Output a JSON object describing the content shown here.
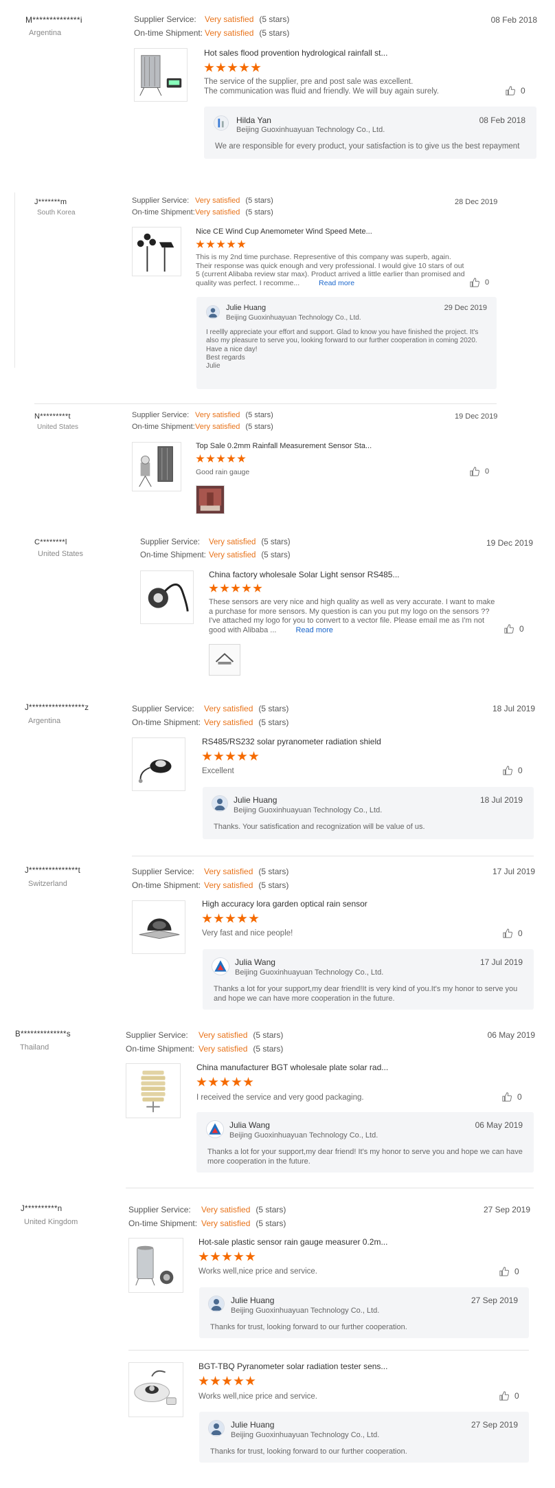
{
  "reviews": [
    {
      "buyer": "M**************i",
      "country": "Argentina",
      "supplier_label": "Supplier Service:",
      "supplier_value": "Very satisfied",
      "supplier_stars": "(5 stars)",
      "shipment_label": "On-time Shipment:",
      "shipment_value": "Very satisfied",
      "shipment_stars": "(5 stars)",
      "date": "08 Feb 2018",
      "products": [
        {
          "title": "Hot sales flood provention hydrological rainfall st...",
          "rating": 5,
          "text": "The service of the supplier, pre and post sale was excellent.\nThe communication was fluid and friendly. We will buy again surely.",
          "likes": "0",
          "thumb_icon": "rain-gauge-station-icon",
          "reply": {
            "name": "Hilda Yan",
            "company": "Beijing Guoxinhuayuan Technology Co., Ltd.",
            "date": "08 Feb 2018",
            "message": "We are responsible for every product, your satisfaction is to give us the best repayment"
          }
        }
      ]
    },
    {
      "buyer": "J*******m",
      "country": "South Korea",
      "supplier_label": "Supplier Service:",
      "supplier_value": "Very satisfied",
      "supplier_stars": "(5 stars)",
      "shipment_label": "On-time Shipment:",
      "shipment_value": "Very satisfied",
      "shipment_stars": "(5 stars)",
      "date": "28 Dec 2019",
      "products": [
        {
          "title": "Nice CE Wind Cup Anemometer Wind Speed Mete...",
          "rating": 5,
          "text": "This is my 2nd time purchase. Representive of this company was superb, again. Their response was quick enough and very professional. I would give 10 stars of out 5 (current Alibaba review star max). Product arrived a little earlier than promised and quality was perfect. I recomme...",
          "read_more": "Read more",
          "likes": "0",
          "thumb_icon": "anemometer-icon",
          "reply": {
            "name": "Julie Huang",
            "company": "Beijing Guoxinhuayuan Technology Co., Ltd.",
            "date": "29 Dec 2019",
            "message": "I reellly appreciate your effort and support. Glad to know you have finished the project. It's also my pleasure to serve you, looking forward to our further cooperation in coming 2020.\nHave a nice day!\nBest regards\nJulie"
          }
        }
      ]
    },
    {
      "buyer": "N*********t",
      "country": "United States",
      "supplier_label": "Supplier Service:",
      "supplier_value": "Very satisfied",
      "supplier_stars": "(5 stars)",
      "shipment_label": "On-time Shipment:",
      "shipment_value": "Very satisfied",
      "shipment_stars": "(5 stars)",
      "date": "19 Dec 2019",
      "products": [
        {
          "title": "Top Sale 0.2mm Rainfall Measurement Sensor Sta...",
          "rating": 5,
          "text": "Good rain gauge",
          "likes": "0",
          "thumb_icon": "rainfall-sensor-icon",
          "attachment": "buyer-photo"
        }
      ]
    },
    {
      "buyer": "C********l",
      "country": "United States",
      "supplier_label": "Supplier Service:",
      "supplier_value": "Very satisfied",
      "supplier_stars": "(5 stars)",
      "shipment_label": "On-time Shipment:",
      "shipment_value": "Very satisfied",
      "shipment_stars": "(5 stars)",
      "date": "19 Dec 2019",
      "products": [
        {
          "title": "China factory wholesale Solar Light sensor RS485...",
          "rating": 5,
          "text": "These sensors are very nice and high quality as well as very accurate. I want to make a purchase for more sensors. My question is can you put my logo on the sensors ?? I've attached my logo for you to convert to a vector file. Please email me as I'm not good with Alibaba ...",
          "read_more": "Read more",
          "likes": "0",
          "thumb_icon": "light-sensor-icon",
          "attachment": "logo-photo"
        }
      ]
    },
    {
      "buyer": "J*****************z",
      "country": "Argentina",
      "supplier_label": "Supplier Service:",
      "supplier_value": "Very satisfied",
      "supplier_stars": "(5 stars)",
      "shipment_label": "On-time Shipment:",
      "shipment_value": "Very satisfied",
      "shipment_stars": "(5 stars)",
      "date": "18 Jul 2019",
      "products": [
        {
          "title": "RS485/RS232 solar pyranometer radiation shield",
          "rating": 5,
          "text": "Excellent",
          "likes": "0",
          "thumb_icon": "pyranometer-icon",
          "reply": {
            "name": "Julie Huang",
            "company": "Beijing Guoxinhuayuan Technology Co., Ltd.",
            "date": "18 Jul 2019",
            "message": "Thanks. Your satisfication and recognization will be value of us."
          }
        }
      ]
    },
    {
      "buyer": "J***************t",
      "country": "Switzerland",
      "supplier_label": "Supplier Service:",
      "supplier_value": "Very satisfied",
      "supplier_stars": "(5 stars)",
      "shipment_label": "On-time Shipment:",
      "shipment_value": "Very satisfied",
      "shipment_stars": "(5 stars)",
      "date": "17 Jul 2019",
      "products": [
        {
          "title": "High accuracy lora garden optical rain sensor",
          "rating": 5,
          "text": "Very fast and nice people!",
          "likes": "0",
          "thumb_icon": "optical-rain-sensor-icon",
          "reply": {
            "name": "Julia Wang",
            "company": "Beijing Guoxinhuayuan Technology Co., Ltd.",
            "date": "17 Jul 2019",
            "message": "Thanks a lot for your support,my dear friend!It is very kind of you.It's my honor to serve you and hope we can have more cooperation in the future."
          }
        }
      ]
    },
    {
      "buyer": "B**************s",
      "country": "Thailand",
      "supplier_label": "Supplier Service:",
      "supplier_value": "Very satisfied",
      "supplier_stars": "(5 stars)",
      "shipment_label": "On-time Shipment:",
      "shipment_value": "Very satisfied",
      "shipment_stars": "(5 stars)",
      "date": "06 May 2019",
      "products": [
        {
          "title": "China manufacturer BGT wholesale plate solar rad...",
          "rating": 5,
          "text": "I received the service and very good packaging.",
          "likes": "0",
          "thumb_icon": "radiation-shield-icon",
          "reply": {
            "name": "Julia Wang",
            "company": "Beijing Guoxinhuayuan Technology Co., Ltd.",
            "date": "06 May 2019",
            "message": "Thanks a lot for your support,my dear friend! It's my honor to serve you and hope we can have more cooperation in the future."
          }
        }
      ]
    },
    {
      "buyer": "J**********n",
      "country": "United Kingdom",
      "supplier_label": "Supplier Service:",
      "supplier_value": "Very satisfied",
      "supplier_stars": "(5 stars)",
      "shipment_label": "On-time Shipment:",
      "shipment_value": "Very satisfied",
      "shipment_stars": "(5 stars)",
      "date": "27 Sep 2019",
      "products": [
        {
          "title": "Hot-sale plastic sensor rain gauge measurer 0.2m...",
          "rating": 5,
          "text": "Works well,nice price and service.",
          "likes": "0",
          "thumb_icon": "rain-gauge-icon",
          "reply": {
            "name": "Julie Huang",
            "company": "Beijing Guoxinhuayuan Technology Co., Ltd.",
            "date": "27 Sep 2019",
            "message": "Thanks for trust, looking forward to our further cooperation."
          }
        },
        {
          "title": "BGT-TBQ Pyranometer solar radiation tester sens...",
          "rating": 5,
          "text": "Works well,nice price and service.",
          "likes": "0",
          "thumb_icon": "pyranometer-tester-icon",
          "reply": {
            "name": "Julie Huang",
            "company": "Beijing Guoxinhuayuan Technology Co., Ltd.",
            "date": "27 Sep 2019",
            "message": "Thanks for trust, looking forward to our further cooperation."
          }
        }
      ]
    }
  ],
  "colors": {
    "accent": "#f56a00",
    "satisfied": "#e8731a",
    "link": "#1a66cc",
    "reply_bg": "#f4f5f7"
  }
}
